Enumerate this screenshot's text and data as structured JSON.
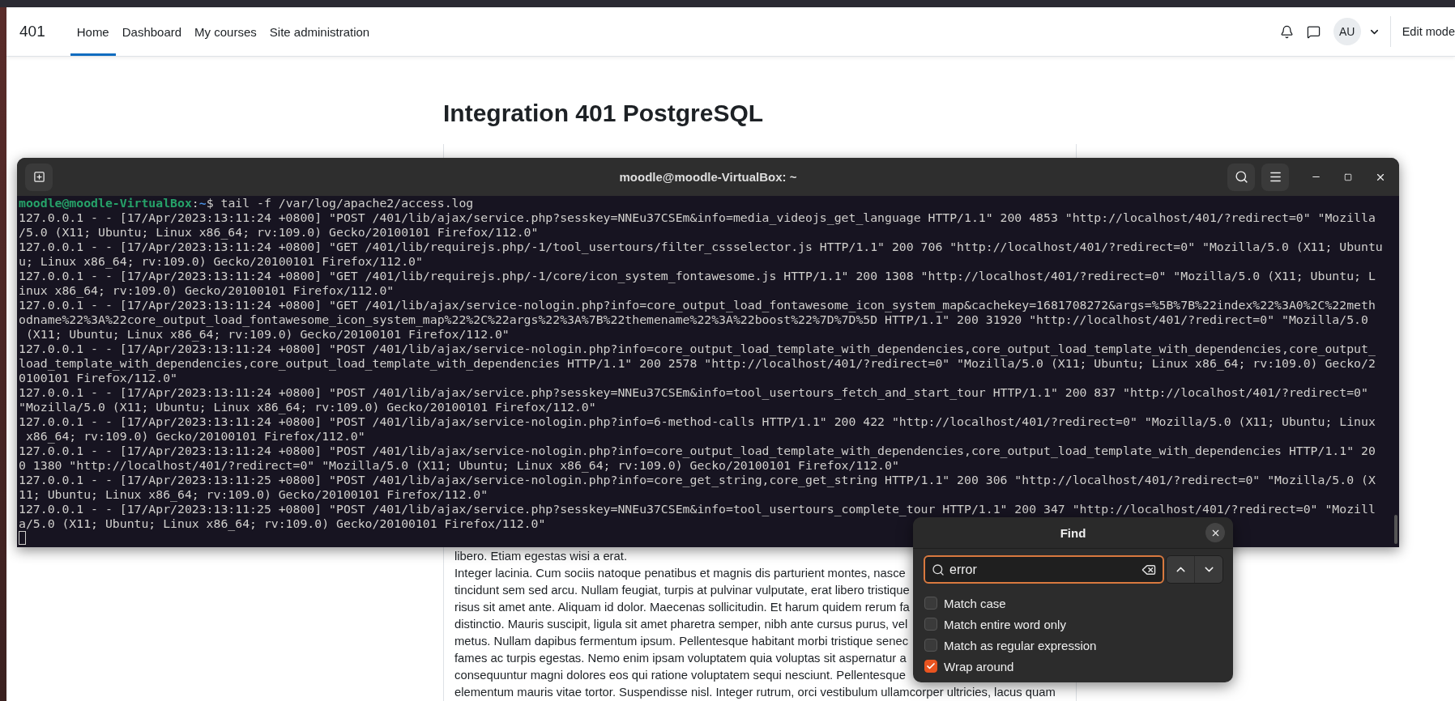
{
  "browser": {
    "site_name": "401",
    "nav": [
      {
        "label": "Home",
        "selected": true
      },
      {
        "label": "Dashboard",
        "selected": false
      },
      {
        "label": "My courses",
        "selected": false
      },
      {
        "label": "Site administration",
        "selected": false
      }
    ],
    "avatar": "AU",
    "edit_mode": "Edit mode"
  },
  "page": {
    "title": "Integration 401 PostgreSQL",
    "body_lines": [
      "libero. Etiam egestas wisi a erat.",
      "Integer lacinia. Cum sociis natoque penatibus et magnis dis parturient montes, nasce",
      "tincidunt sem sed arcu. Nullam feugiat, turpis at pulvinar vulputate, erat libero tristique",
      "risus sit amet ante. Aliquam id dolor. Maecenas sollicitudin. Et harum quidem rerum fa",
      "distinctio. Mauris suscipit, ligula sit amet pharetra semper, nibh ante cursus purus, vel",
      "metus. Nullam dapibus fermentum ipsum. Pellentesque habitant morbi tristique senec",
      "fames ac turpis egestas. Nemo enim ipsam voluptatem quia voluptas sit aspernatur a",
      "consequuntur magni dolores eos qui ratione voluptatem sequi nesciunt. Pellentesque",
      "elementum mauris vitae tortor. Suspendisse nisl. Integer rutrum, orci vestibulum ullamcorper ultricies, lacus quam"
    ]
  },
  "terminal": {
    "title": "moodle@moodle-VirtualBox: ~",
    "prompt": [
      {
        "kind": "host",
        "text": "moodle@moodle-VirtualBox"
      },
      {
        "kind": "plain",
        "text": ":"
      },
      {
        "kind": "path",
        "text": "~"
      },
      {
        "kind": "plain",
        "text": "$ tail -f /var/log/apache2/access.log"
      }
    ],
    "lines": [
      "127.0.0.1 - - [17/Apr/2023:13:11:24 +0800] \"POST /401/lib/ajax/service.php?sesskey=NNEu37CSEm&info=media_videojs_get_language HTTP/1.1\" 200 4853 \"http://localhost/401/?redirect=0\" \"Mozilla",
      "/5.0 (X11; Ubuntu; Linux x86_64; rv:109.0) Gecko/20100101 Firefox/112.0\"",
      "127.0.0.1 - - [17/Apr/2023:13:11:24 +0800] \"GET /401/lib/requirejs.php/-1/tool_usertours/filter_cssselector.js HTTP/1.1\" 200 706 \"http://localhost/401/?redirect=0\" \"Mozilla/5.0 (X11; Ubuntu",
      "u; Linux x86_64; rv:109.0) Gecko/20100101 Firefox/112.0\"",
      "127.0.0.1 - - [17/Apr/2023:13:11:24 +0800] \"GET /401/lib/requirejs.php/-1/core/icon_system_fontawesome.js HTTP/1.1\" 200 1308 \"http://localhost/401/?redirect=0\" \"Mozilla/5.0 (X11; Ubuntu; L",
      "inux x86_64; rv:109.0) Gecko/20100101 Firefox/112.0\"",
      "127.0.0.1 - - [17/Apr/2023:13:11:24 +0800] \"GET /401/lib/ajax/service-nologin.php?info=core_output_load_fontawesome_icon_system_map&cachekey=1681708272&args=%5B%7B%22index%22%3A0%2C%22meth",
      "odname%22%3A%22core_output_load_fontawesome_icon_system_map%22%2C%22args%22%3A%7B%22themename%22%3A%22boost%22%7D%7D%5D HTTP/1.1\" 200 31920 \"http://localhost/401/?redirect=0\" \"Mozilla/5.0",
      " (X11; Ubuntu; Linux x86_64; rv:109.0) Gecko/20100101 Firefox/112.0\"",
      "127.0.0.1 - - [17/Apr/2023:13:11:24 +0800] \"POST /401/lib/ajax/service-nologin.php?info=core_output_load_template_with_dependencies,core_output_load_template_with_dependencies,core_output_",
      "load_template_with_dependencies,core_output_load_template_with_dependencies HTTP/1.1\" 200 2578 \"http://localhost/401/?redirect=0\" \"Mozilla/5.0 (X11; Ubuntu; Linux x86_64; rv:109.0) Gecko/2",
      "0100101 Firefox/112.0\"",
      "127.0.0.1 - - [17/Apr/2023:13:11:24 +0800] \"POST /401/lib/ajax/service.php?sesskey=NNEu37CSEm&info=tool_usertours_fetch_and_start_tour HTTP/1.1\" 200 837 \"http://localhost/401/?redirect=0\"",
      "\"Mozilla/5.0 (X11; Ubuntu; Linux x86_64; rv:109.0) Gecko/20100101 Firefox/112.0\"",
      "127.0.0.1 - - [17/Apr/2023:13:11:24 +0800] \"POST /401/lib/ajax/service-nologin.php?info=6-method-calls HTTP/1.1\" 200 422 \"http://localhost/401/?redirect=0\" \"Mozilla/5.0 (X11; Ubuntu; Linux",
      " x86_64; rv:109.0) Gecko/20100101 Firefox/112.0\"",
      "127.0.0.1 - - [17/Apr/2023:13:11:24 +0800] \"POST /401/lib/ajax/service-nologin.php?info=core_output_load_template_with_dependencies,core_output_load_template_with_dependencies HTTP/1.1\" 20",
      "0 1380 \"http://localhost/401/?redirect=0\" \"Mozilla/5.0 (X11; Ubuntu; Linux x86_64; rv:109.0) Gecko/20100101 Firefox/112.0\"",
      "127.0.0.1 - - [17/Apr/2023:13:11:25 +0800] \"POST /401/lib/ajax/service-nologin.php?info=core_get_string,core_get_string HTTP/1.1\" 200 306 \"http://localhost/401/?redirect=0\" \"Mozilla/5.0 (X",
      "11; Ubuntu; Linux x86_64; rv:109.0) Gecko/20100101 Firefox/112.0\"",
      "127.0.0.1 - - [17/Apr/2023:13:11:25 +0800] \"POST /401/lib/ajax/service.php?sesskey=NNEu37CSEm&info=tool_usertours_complete_tour HTTP/1.1\" 200 347 \"http://localhost/401/?redirect=0\" \"Mozill",
      "a/5.0 (X11; Ubuntu; Linux x86_64; rv:109.0) Gecko/20100101 Firefox/112.0\""
    ]
  },
  "find_dialog": {
    "title": "Find",
    "query": "error",
    "options": [
      {
        "label": "Match case",
        "checked": false
      },
      {
        "label": "Match entire word only",
        "checked": false
      },
      {
        "label": "Match as regular expression",
        "checked": false
      },
      {
        "label": "Wrap around",
        "checked": true
      }
    ]
  }
}
